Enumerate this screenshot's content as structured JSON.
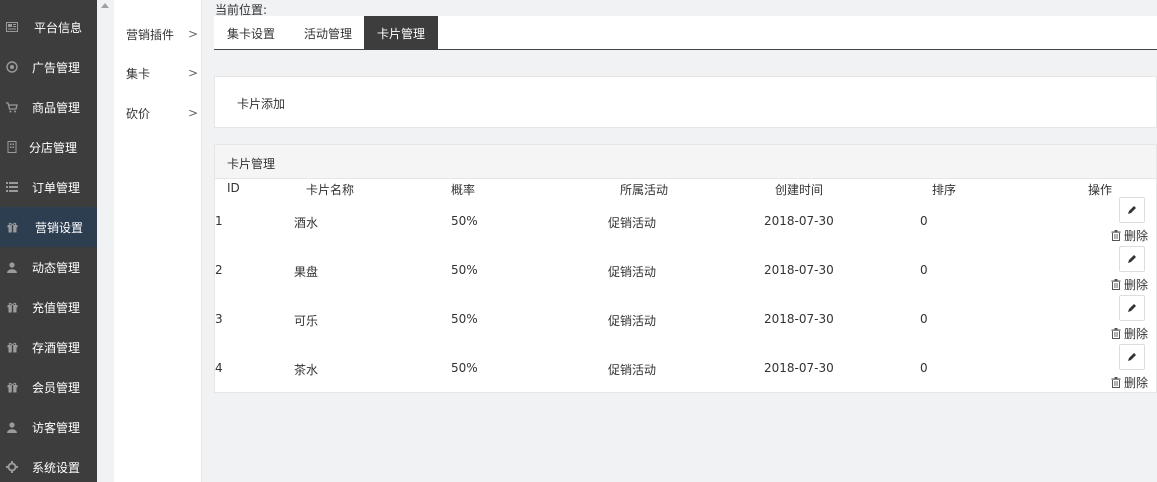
{
  "sidebar": {
    "items": [
      {
        "label": "平台信息",
        "icon": "newspaper-icon"
      },
      {
        "label": "广告管理",
        "icon": "globe-icon"
      },
      {
        "label": "商品管理",
        "icon": "cart-icon"
      },
      {
        "label": "分店管理",
        "icon": "building-icon"
      },
      {
        "label": "订单管理",
        "icon": "list-icon"
      },
      {
        "label": "营销设置",
        "icon": "gift-icon"
      },
      {
        "label": "动态管理",
        "icon": "user-icon"
      },
      {
        "label": "充值管理",
        "icon": "gift-icon"
      },
      {
        "label": "存酒管理",
        "icon": "gift-icon"
      },
      {
        "label": "会员管理",
        "icon": "gift-icon"
      },
      {
        "label": "访客管理",
        "icon": "user-icon"
      },
      {
        "label": "系统设置",
        "icon": "gear-icon"
      }
    ],
    "active_index": 5
  },
  "subnav": {
    "items": [
      {
        "label": "营销插件"
      },
      {
        "label": "集卡"
      },
      {
        "label": "砍价"
      }
    ]
  },
  "main": {
    "breadcrumb": "当前位置:",
    "tabs": [
      {
        "label": "集卡设置"
      },
      {
        "label": "活动管理"
      },
      {
        "label": "卡片管理"
      }
    ],
    "active_tab": 2,
    "add_label": "卡片添加",
    "list_title": "卡片管理"
  },
  "table": {
    "columns": [
      "ID",
      "卡片名称",
      "概率",
      "所属活动",
      "创建时间",
      "排序",
      "操作"
    ],
    "rows": [
      {
        "id": "1",
        "name": "酒水",
        "prob": "50%",
        "activity": "促销活动",
        "created": "2018-07-30",
        "sort": "0"
      },
      {
        "id": "2",
        "name": "果盘",
        "prob": "50%",
        "activity": "促销活动",
        "created": "2018-07-30",
        "sort": "0"
      },
      {
        "id": "3",
        "name": "可乐",
        "prob": "50%",
        "activity": "促销活动",
        "created": "2018-07-30",
        "sort": "0"
      },
      {
        "id": "4",
        "name": "茶水",
        "prob": "50%",
        "activity": "促销活动",
        "created": "2018-07-30",
        "sort": "0"
      }
    ],
    "delete_label": "删除"
  },
  "colors": {
    "sidebar_bg": "#3d3d3d",
    "sidebar_active": "#2c3e50",
    "tab_active": "#3d3d3d"
  }
}
